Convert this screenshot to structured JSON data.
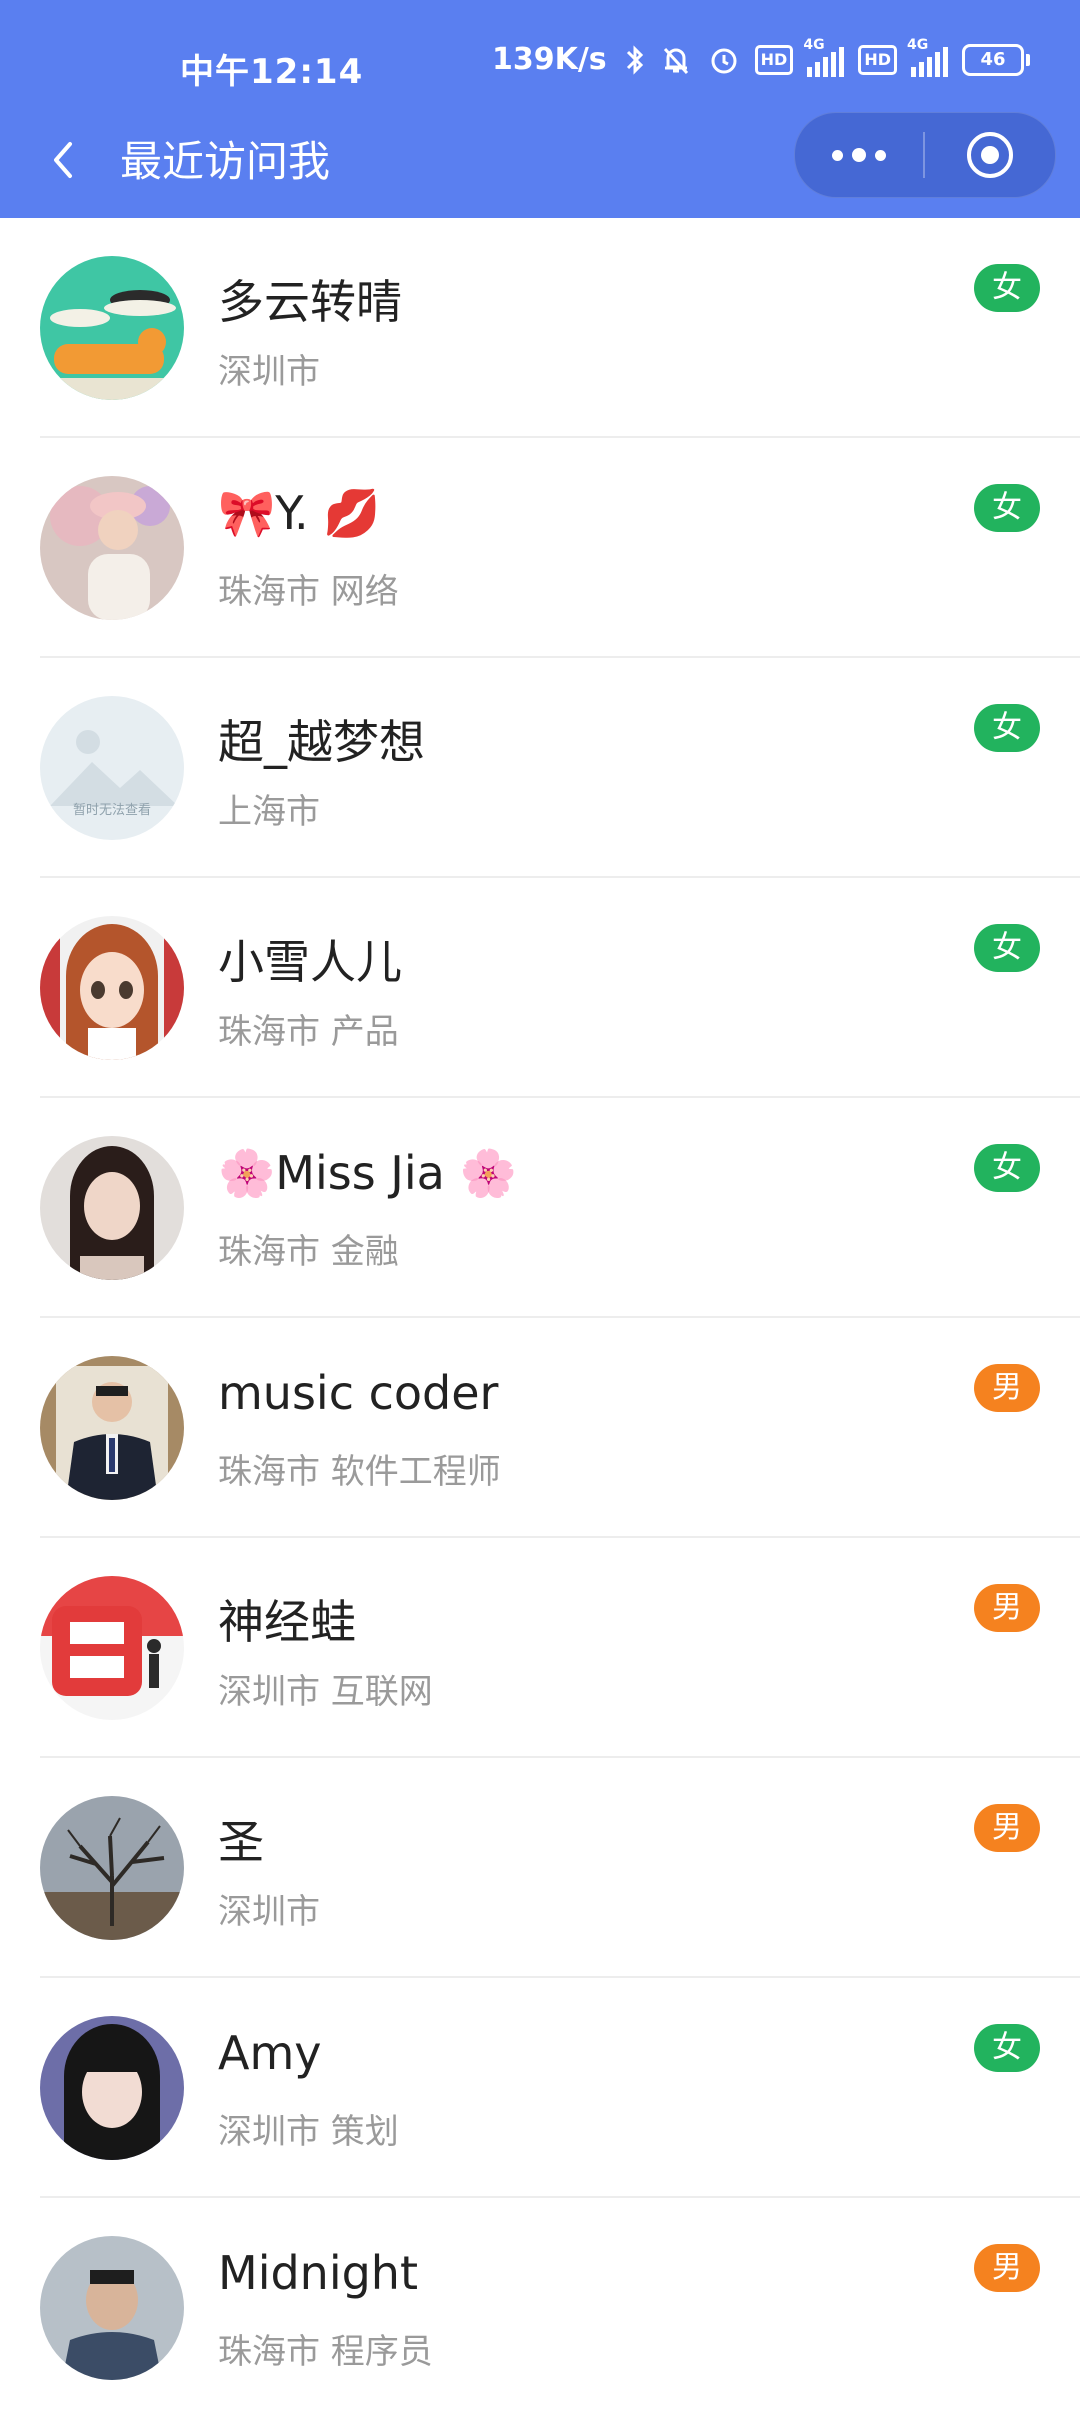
{
  "status": {
    "time": "中午12:14",
    "speed": "139K/s",
    "hd": "HD",
    "network": "4G",
    "battery": "46"
  },
  "nav": {
    "title": "最近访问我"
  },
  "visitors": [
    {
      "name": "多云转晴",
      "info": "深圳市",
      "gender": "女"
    },
    {
      "name": "🎀Y. 💋",
      "info": "珠海市 网络",
      "gender": "女"
    },
    {
      "name": "超_越梦想",
      "info": "上海市",
      "gender": "女",
      "avatar_text": "暂时无法查看"
    },
    {
      "name": "小雪人儿",
      "info": "珠海市 产品",
      "gender": "女"
    },
    {
      "name": "🌸Miss Jia 🌸",
      "info": "珠海市 金融",
      "gender": "女"
    },
    {
      "name": "music coder",
      "info": "珠海市 软件工程师",
      "gender": "男"
    },
    {
      "name": "神经蛙",
      "info": "深圳市 互联网",
      "gender": "男"
    },
    {
      "name": "圣",
      "info": "深圳市",
      "gender": "男"
    },
    {
      "name": "Amy",
      "info": "深圳市 策划",
      "gender": "女"
    },
    {
      "name": "Midnight",
      "info": "珠海市 程序员",
      "gender": "男"
    }
  ],
  "colors": {
    "header": "#5a7ff0",
    "female": "#22b35e",
    "male": "#f5821f"
  }
}
